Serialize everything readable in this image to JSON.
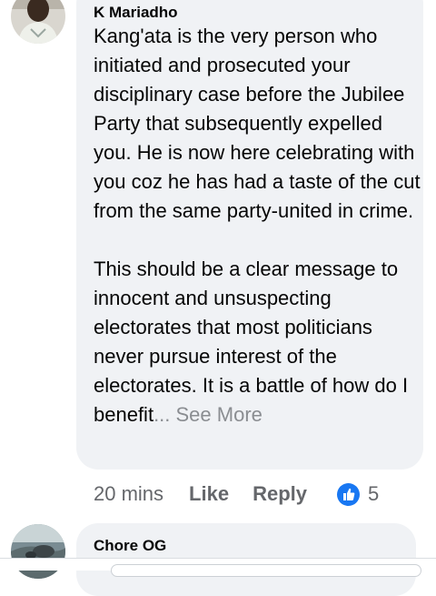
{
  "comment1": {
    "author": "K Mariadho",
    "paragraph1": "Kang'ata is the very person who initiated and prosecuted your disciplinary case before the Jubilee Party that subsequently expelled you. He is now here celebrating with you coz he has had a taste of the cut from the same party-united in crime.",
    "paragraph2": "This should be a clear message to innocent and unsuspecting electorates that most politicians never pursue interest of the electorates. It is a battle of how do I benefit",
    "ellipsis_more": "... See More",
    "time": "20 mins",
    "like_label": "Like",
    "reply_label": "Reply",
    "reaction_icon": "like-thumb-icon",
    "reaction_count": "5"
  },
  "comment2": {
    "author": "Chore OG"
  },
  "colors": {
    "bubble": "#f0f2f5",
    "meta_text": "#65676b",
    "like_blue": "#1877f2"
  }
}
